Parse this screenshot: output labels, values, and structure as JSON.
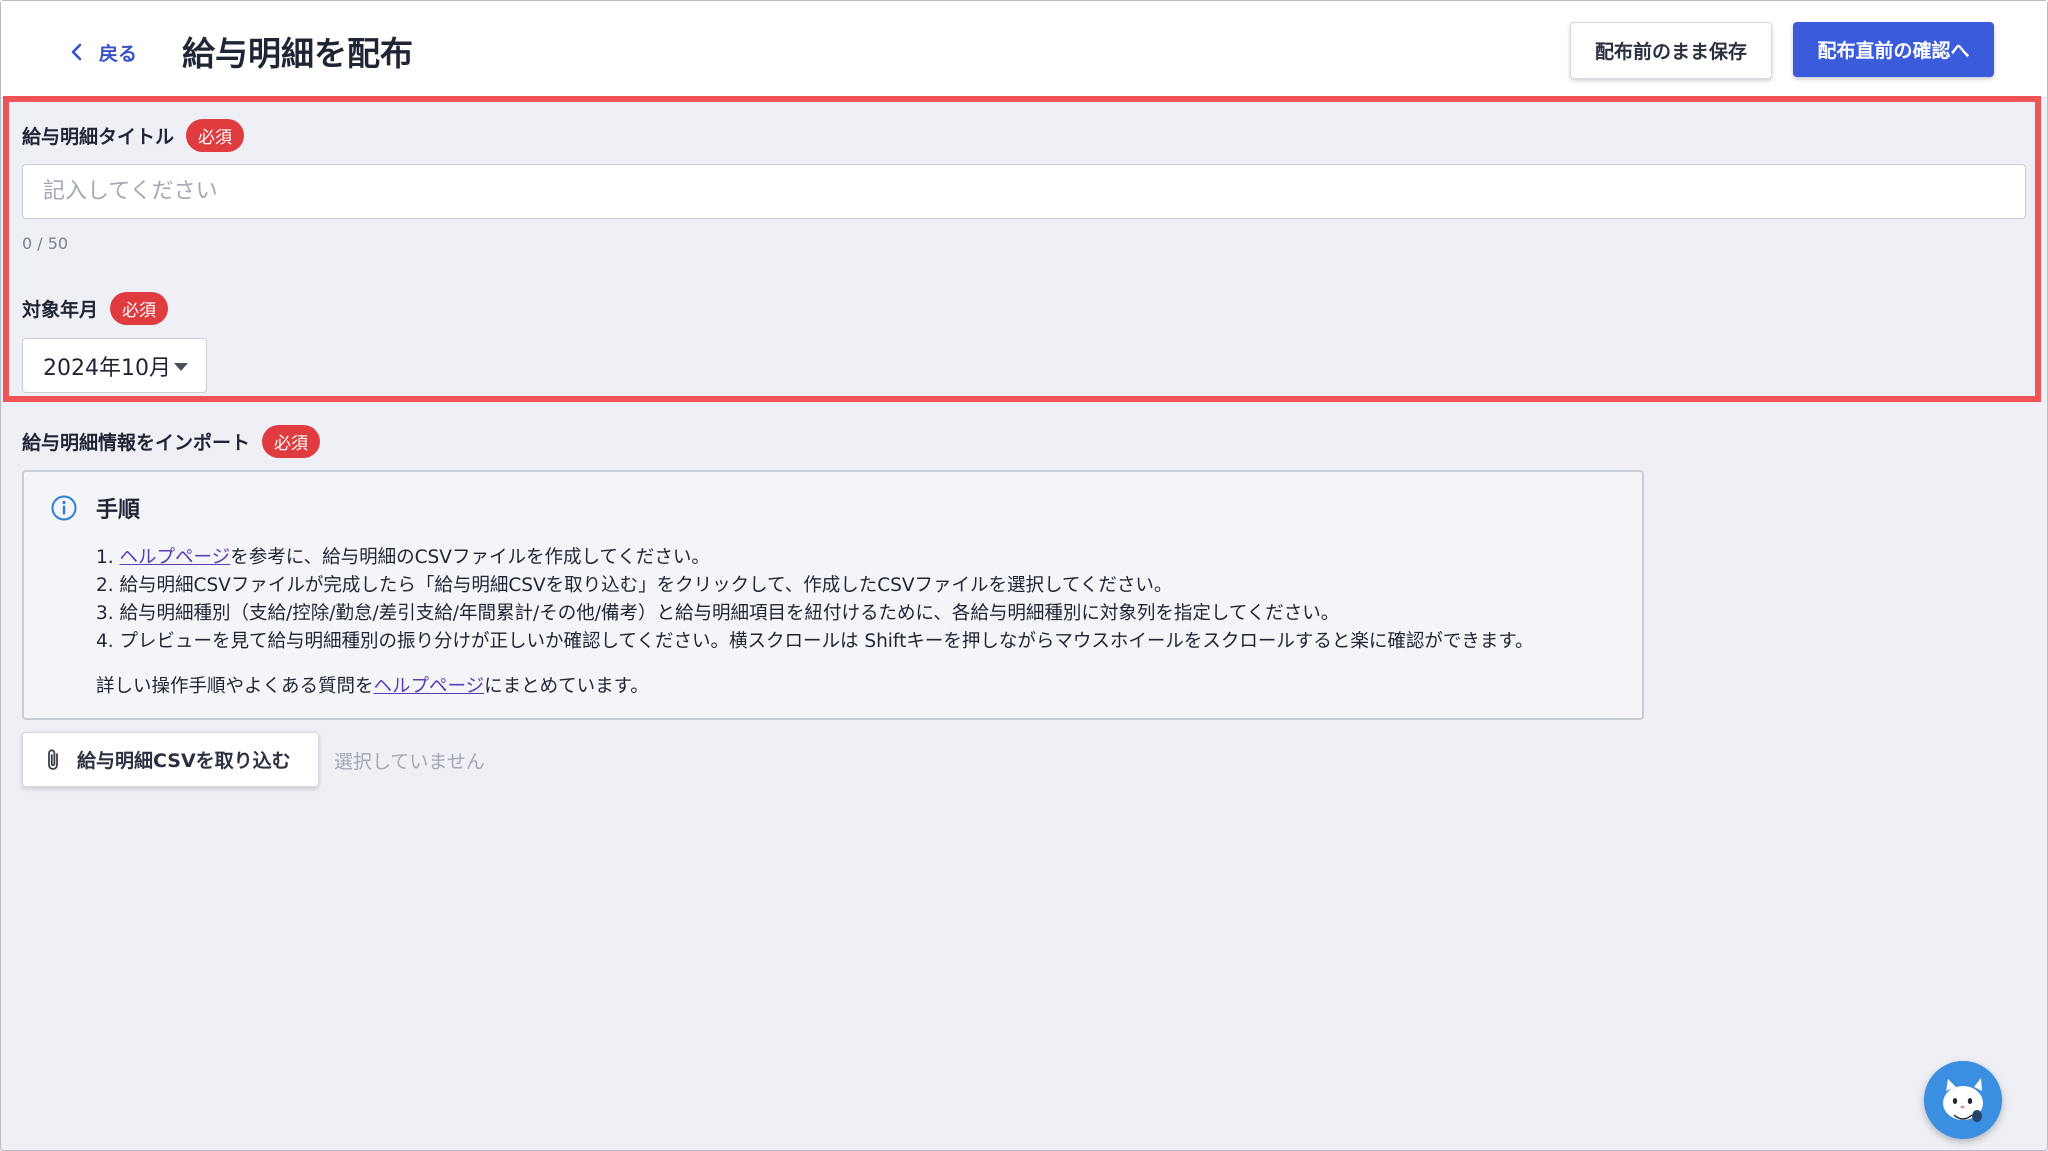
{
  "header": {
    "back_label": "戻る",
    "title": "給与明細を配布",
    "save_draft_label": "配布前のまま保存",
    "confirm_label": "配布直前の確認へ"
  },
  "title_field": {
    "label": "給与明細タイトル",
    "required_badge": "必須",
    "placeholder": "記入してください",
    "value": "",
    "char_count": "0 / 50"
  },
  "month_field": {
    "label": "対象年月",
    "required_badge": "必須",
    "selected": "2024年10月"
  },
  "import_section": {
    "label": "給与明細情報をインポート",
    "required_badge": "必須",
    "instructions": {
      "title": "手順",
      "steps": [
        {
          "num": "1. ",
          "link": "ヘルプページ",
          "text": "を参考に、給与明細のCSVファイルを作成してください。"
        },
        {
          "num": "2. ",
          "text": "給与明細CSVファイルが完成したら「給与明細CSVを取り込む」をクリックして、作成したCSVファイルを選択してください。"
        },
        {
          "num": "3. ",
          "text": "給与明細種別（支給/控除/勤怠/差引支給/年間累計/その他/備考）と給与明細項目を紐付けるために、各給与明細種別に対象列を指定してください。"
        },
        {
          "num": "4. ",
          "text": "プレビューを見て給与明細種別の振り分けが正しいか確認してください。横スクロールは Shiftキーを押しながらマウスホイールをスクロールすると楽に確認ができます。"
        }
      ],
      "detail_prefix": "詳しい操作手順やよくある質問を",
      "detail_link": "ヘルプページ",
      "detail_suffix": "にまとめています。"
    },
    "import_button_label": "給与明細CSVを取り込む",
    "file_status": "選択していません"
  },
  "colors": {
    "primary": "#3a5bdc",
    "required_badge": "#e03b3f",
    "highlight_border": "#ef5356",
    "link": "#5b3cb8"
  },
  "icons": [
    "chevron-left-icon",
    "info-icon",
    "paperclip-icon",
    "chat-assistant-icon"
  ]
}
